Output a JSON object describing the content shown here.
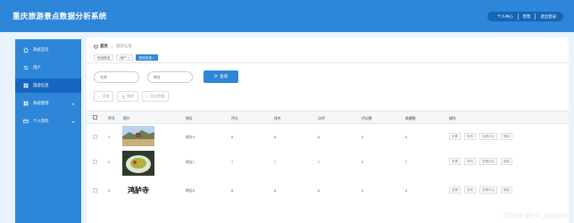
{
  "app_title": "重庆旅游景点数据分析系统",
  "header_nav": {
    "items": [
      "个人中心",
      "帮帮",
      "退出登录"
    ]
  },
  "sidebar": {
    "items": [
      {
        "label": "系统首页",
        "icon": "home-icon"
      },
      {
        "label": "用户",
        "icon": "sliders-icon"
      },
      {
        "label": "旅游信息",
        "icon": "grid-icon",
        "active": true
      },
      {
        "label": "系统管理",
        "icon": "grid-icon",
        "has_submenu": true
      },
      {
        "label": "个人资料",
        "icon": "card-icon",
        "has_submenu": true
      }
    ]
  },
  "breadcrumb": {
    "home": "首页",
    "current": "旅游信息"
  },
  "tabs": [
    "系统首页",
    "用户",
    "旅游信息"
  ],
  "search": {
    "field1_placeholder": "名称",
    "field2_placeholder": "地址",
    "button_label": "查询"
  },
  "actions": {
    "add": "添加",
    "delete": "删除",
    "export": "导出数据"
  },
  "table": {
    "headers": [
      "序号",
      "图片",
      "地址",
      "评分",
      "排名",
      "点评",
      "评论数",
      "收藏数",
      "操作"
    ],
    "rows": [
      {
        "index": "1",
        "address": "地址9",
        "score": "8",
        "rank": "8",
        "review": "6",
        "comment_count": "0",
        "fav_count": "6",
        "image": "landscape"
      },
      {
        "index": "2",
        "address": "地址7",
        "score": "7",
        "rank": "7",
        "review": "7",
        "comment_count": "0",
        "fav_count": "7",
        "image": "food-bowl"
      },
      {
        "index": "3",
        "address": "地址5",
        "score": "8",
        "rank": "6",
        "review": "6",
        "comment_count": "0",
        "fav_count": "6",
        "image": "calligraphy",
        "image_text": "鸿胪寺"
      }
    ],
    "ops": [
      "查看",
      "修改",
      "查看评论",
      "删除"
    ]
  },
  "watermark": "CSDN @VX_bszj266",
  "colors": {
    "brand": "#2e86d8",
    "active": "#1566c0",
    "background": "#e8f3fb"
  }
}
